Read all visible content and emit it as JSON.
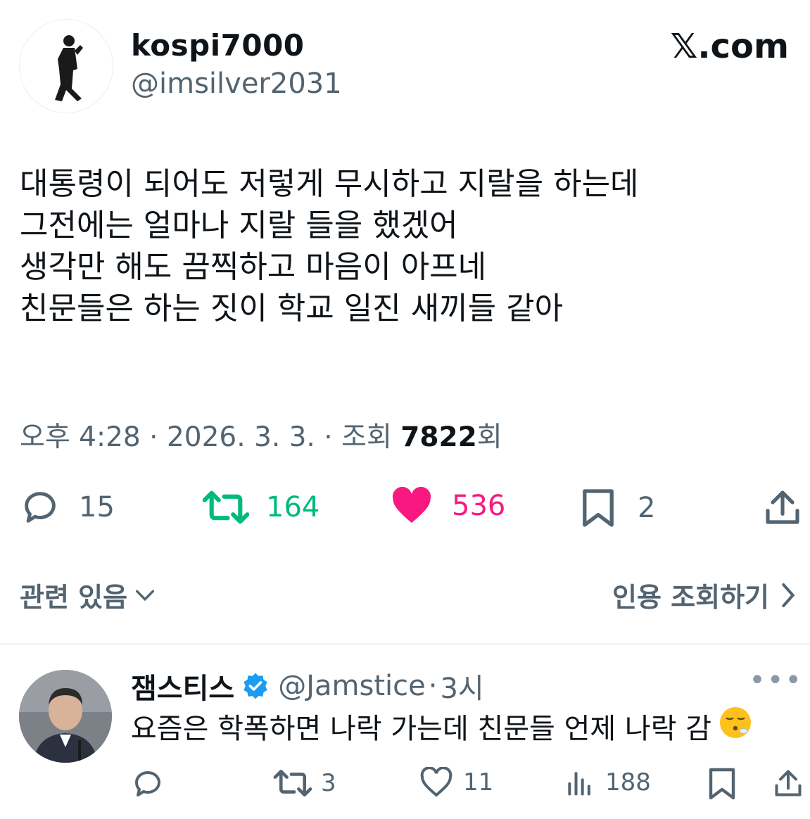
{
  "author": {
    "name": "kospi7000",
    "handle": "@imsilver2031"
  },
  "site_label": "𝕏.com",
  "tweet": {
    "lines": [
      "대통령이 되어도 저렇게 무시하고 지랄을 하는데",
      "그전에는 얼마나 지랄 들을 했겠어",
      "생각만 해도 끔찍하고 마음이 아프네",
      "친문들은 하는 짓이 학교 일진 새끼들 같아"
    ],
    "time": "오후 4:28",
    "date": "2026. 3. 3.",
    "views_label": "조회",
    "views_count": "7822",
    "views_suffix": "회",
    "sep": "·"
  },
  "actions": {
    "replies": "15",
    "retweets": "164",
    "likes": "536",
    "bookmarks": "2"
  },
  "related_label": "관련 있음",
  "quotes_label": "인용 조회하기",
  "reply": {
    "name": "잼스티스",
    "handle": "@Jamstice",
    "time": "3시",
    "text": "요즘은 학폭하면 나락 가는데 친문들 언제 나락 감",
    "emoji": "😮‍💨",
    "actions": {
      "replies": "",
      "retweets": "3",
      "likes": "11",
      "views": "188"
    }
  },
  "colors": {
    "retweet": "#00ba7c",
    "like": "#f91880",
    "verified": "#1d9bf0",
    "secondary": "#536471"
  }
}
